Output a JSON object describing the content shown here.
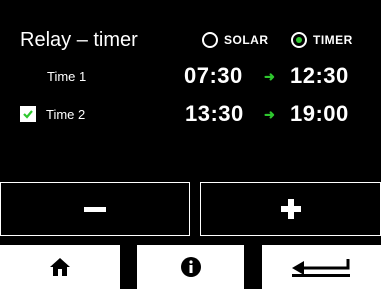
{
  "header": {
    "title": "Relay – timer",
    "modes": [
      {
        "label": "SOLAR",
        "selected": false
      },
      {
        "label": "TIMER",
        "selected": true
      }
    ]
  },
  "schedule": {
    "rows": [
      {
        "label": "Time 1",
        "checked": null,
        "start": "07:30",
        "end": "12:30"
      },
      {
        "label": "Time 2",
        "checked": true,
        "start": "13:30",
        "end": "19:00"
      }
    ],
    "arrow": "➜"
  },
  "colors": {
    "accent": "#2ec72e",
    "background": "#000000",
    "foreground": "#ffffff"
  },
  "icons": {
    "decrease": "minus-icon",
    "increase": "plus-icon",
    "home": "home-icon",
    "info": "info-icon",
    "back": "back-arrow-icon"
  }
}
